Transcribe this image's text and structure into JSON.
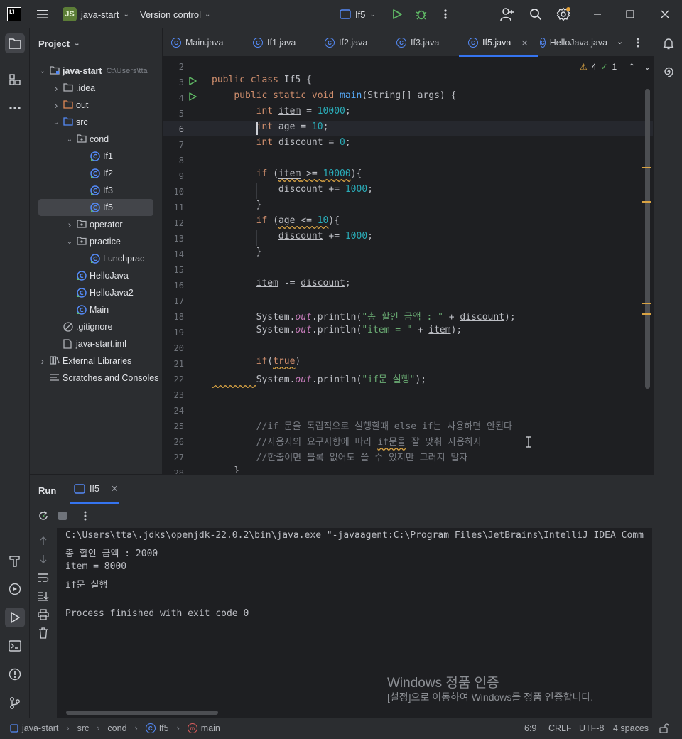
{
  "titlebar": {
    "logo_text": "IJ",
    "project_badge": "JS",
    "project_name": "java-start",
    "vcs_label": "Version control",
    "run_config": "If5"
  },
  "project_panel": {
    "title": "Project",
    "tree": [
      {
        "label": "java-start",
        "hint": "C:\\Users\\tta",
        "icon": "module-folder-icon",
        "twisty": "v",
        "indent": 0
      },
      {
        "label": ".idea",
        "icon": "folder-icon",
        "twisty": ">",
        "indent": 1
      },
      {
        "label": "out",
        "icon": "folder-orange-icon",
        "twisty": ">",
        "indent": 1
      },
      {
        "label": "src",
        "icon": "source-folder-icon",
        "twisty": "v",
        "indent": 1
      },
      {
        "label": "cond",
        "icon": "package-icon",
        "twisty": "v",
        "indent": 2
      },
      {
        "label": "If1",
        "icon": "java-class-icon",
        "twisty": "",
        "indent": 3
      },
      {
        "label": "If2",
        "icon": "java-class-icon",
        "twisty": "",
        "indent": 3
      },
      {
        "label": "If3",
        "icon": "java-class-icon",
        "twisty": "",
        "indent": 3
      },
      {
        "label": "If5",
        "icon": "java-class-icon",
        "twisty": "",
        "indent": 3,
        "selected": true
      },
      {
        "label": "operator",
        "icon": "package-icon",
        "twisty": ">",
        "indent": 2
      },
      {
        "label": "practice",
        "icon": "package-icon",
        "twisty": "v",
        "indent": 2
      },
      {
        "label": "Lunchprac",
        "icon": "java-class-icon",
        "twisty": "",
        "indent": 3
      },
      {
        "label": "HelloJava",
        "icon": "java-class-icon",
        "twisty": "",
        "indent": 2
      },
      {
        "label": "HelloJava2",
        "icon": "java-class-icon",
        "twisty": "",
        "indent": 2
      },
      {
        "label": "Main",
        "icon": "java-class-icon",
        "twisty": "",
        "indent": 2
      },
      {
        "label": ".gitignore",
        "icon": "ignore-file-icon",
        "twisty": "",
        "indent": 1
      },
      {
        "label": "java-start.iml",
        "icon": "file-icon",
        "twisty": "",
        "indent": 1
      },
      {
        "label": "External Libraries",
        "icon": "library-icon",
        "twisty": ">",
        "indent": 0
      },
      {
        "label": "Scratches and Consoles",
        "icon": "scratches-icon",
        "twisty": "",
        "indent": 0
      }
    ]
  },
  "tabs": [
    {
      "label": "Main.java",
      "active": false
    },
    {
      "label": "If1.java",
      "active": false
    },
    {
      "label": "If2.java",
      "active": false
    },
    {
      "label": "If3.java",
      "active": false
    },
    {
      "label": "If5.java",
      "active": true
    },
    {
      "label": "HelloJava.java",
      "active": false
    }
  ],
  "inspections": {
    "warnings": "4",
    "weak_warnings": "1"
  },
  "editor": {
    "line_numbers": [
      "2",
      "3",
      "4",
      "5",
      "6",
      "7",
      "8",
      "9",
      "10",
      "11",
      "12",
      "13",
      "14",
      "15",
      "16",
      "17",
      "18",
      "19",
      "20",
      "21",
      "22",
      "23",
      "24",
      "25",
      "26",
      "27",
      "28"
    ]
  },
  "run_panel": {
    "title": "Run",
    "tab_label": "If5",
    "console": [
      "C:\\Users\\tta\\.jdks\\openjdk-22.0.2\\bin\\java.exe \"-javaagent:C:\\Program Files\\JetBrains\\IntelliJ IDEA Comm",
      "총 할인 금액 : 2000",
      "item = 8000",
      "if문 실행",
      "",
      "Process finished with exit code 0"
    ]
  },
  "watermark": {
    "line1": "Windows 정품 인증",
    "line2": "[설정]으로 이동하여 Windows를 정품 인증합니다."
  },
  "statusbar": {
    "breadcrumbs": [
      "java-start",
      "src",
      "cond",
      "If5",
      "main"
    ],
    "position": "6:9",
    "line_sep": "CRLF",
    "encoding": "UTF-8",
    "indent": "4 spaces"
  },
  "colors": {
    "accent": "#3574f0",
    "keyword": "#cf8e6d",
    "number": "#2aacb8",
    "string": "#6aab73",
    "warning": "#d9a343"
  }
}
